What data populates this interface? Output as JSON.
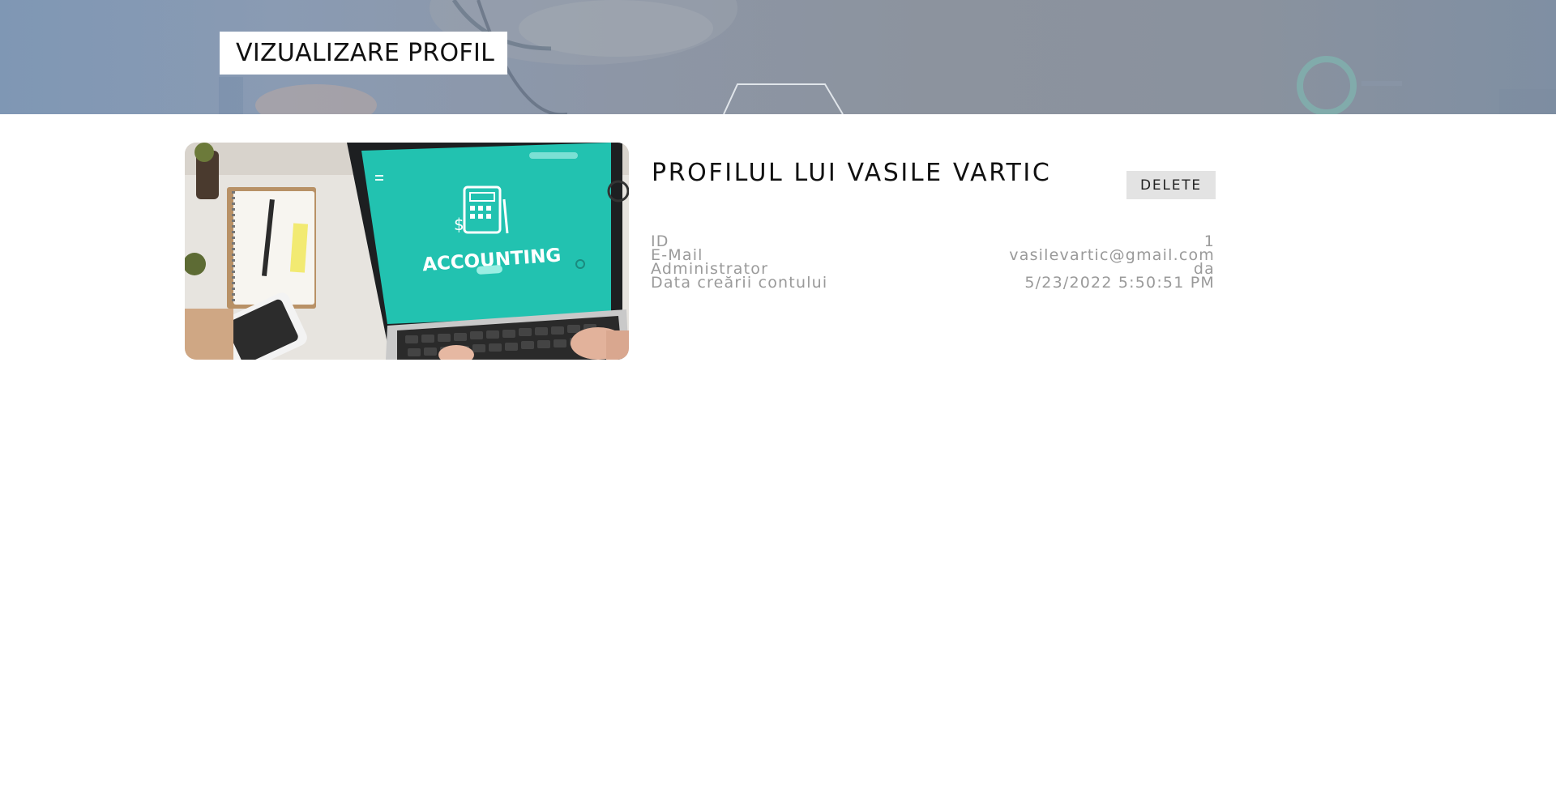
{
  "header": {
    "title": "VIZUALIZARE PROFIL"
  },
  "profile": {
    "title": "PROFILUL LUI VASILE VARTIC",
    "image_text": "ACCOUNTING",
    "delete_label": "DELETE",
    "fields": [
      {
        "label": "ID",
        "value": "1"
      },
      {
        "label": "E-Mail",
        "value": "vasilevartic@gmail.com"
      },
      {
        "label": "Administrator",
        "value": "da"
      },
      {
        "label": "Data creării contului",
        "value": "5/23/2022 5:50:51 PM"
      }
    ]
  },
  "colors": {
    "hero_overlay": "#8a96a8",
    "accent_teal": "#21bfae",
    "button_bg": "#e3e3e3",
    "field_text": "#9a9a9a"
  }
}
